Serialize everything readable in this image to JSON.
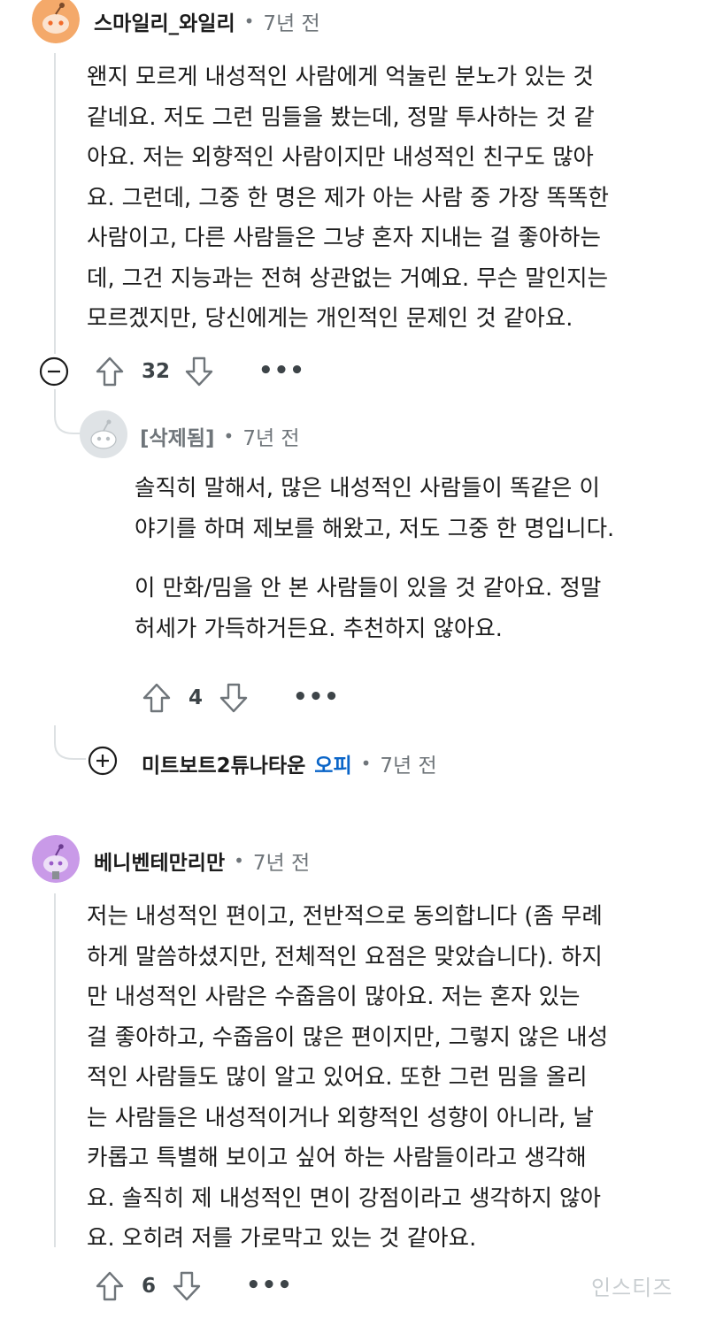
{
  "comments": [
    {
      "username": "스마일리_와일리",
      "time": "7년 전",
      "text_lines": [
        "왠지 모르게 내성적인 사람에게 억눌린 분노가 있는 것",
        "같네요. 저도 그런 밈들을 봤는데, 정말 투사하는 것 같",
        "아요. 저는 외향적인 사람이지만 내성적인 친구도 많아",
        "요. 그런데, 그중 한 명은 제가 아는 사람 중 가장 똑똑한",
        "사람이고, 다른 사람들은 그냥 혼자 지내는 걸 좋아하는",
        "데, 그건 지능과는 전혀 상관없는 거예요. 무슨 말인지는",
        "모르겠지만, 당신에게는 개인적인 문제인 것 같아요."
      ],
      "votes": "32",
      "avatar_color": "#f4a96a"
    },
    {
      "username": "[삭제됨]",
      "time": "7년 전",
      "text_lines": [
        "솔직히 말해서, 많은 내성적인 사람들이 똑같은 이",
        "야기를 하며 제보를 해왔고, 저도 그중 한 명입니다.",
        "",
        "이 만화/밈을 안 본 사람들이 있을 것 같아요. 정말",
        "허세가 가득하거든요. 추천하지 않아요."
      ],
      "votes": "4",
      "avatar_color": "#dfe3e6"
    },
    {
      "username": "미트보트2튜나타운",
      "badge": "오피",
      "time": "7년 전"
    },
    {
      "username": "베니벤테만리만",
      "time": "7년 전",
      "text_lines": [
        "저는 내성적인 편이고, 전반적으로 동의합니다 (좀 무례",
        "하게 말씀하셨지만, 전체적인 요점은 맞았습니다). 하지",
        "만 내성적인 사람은 수줍음이 많아요. 저는 혼자 있는",
        "걸 좋아하고, 수줍음이 많은 편이지만, 그렇지 않은 내성",
        "적인 사람들도 많이 알고 있어요. 또한 그런 밈을 올리",
        "는 사람들은 내성적이거나 외향적인 성향이 아니라, 날",
        "카롭고 특별해 보이고 싶어 하는 사람들이라고 생각해",
        "요. 솔직히 제 내성적인 면이 강점이라고 생각하지 않아",
        "요. 오히려 저를 가로막고 있는 것 같아요."
      ],
      "votes": "6",
      "avatar_color": "#c99ae8"
    }
  ],
  "ui": {
    "separator": "•",
    "more": "•••",
    "collapse_symbol": "−",
    "expand_symbol": "+",
    "watermark": "인스티즈"
  },
  "colors": {
    "badge_blue": "#0a65c8",
    "thread_line": "#dde1e3",
    "meta_gray": "#6f757a"
  }
}
